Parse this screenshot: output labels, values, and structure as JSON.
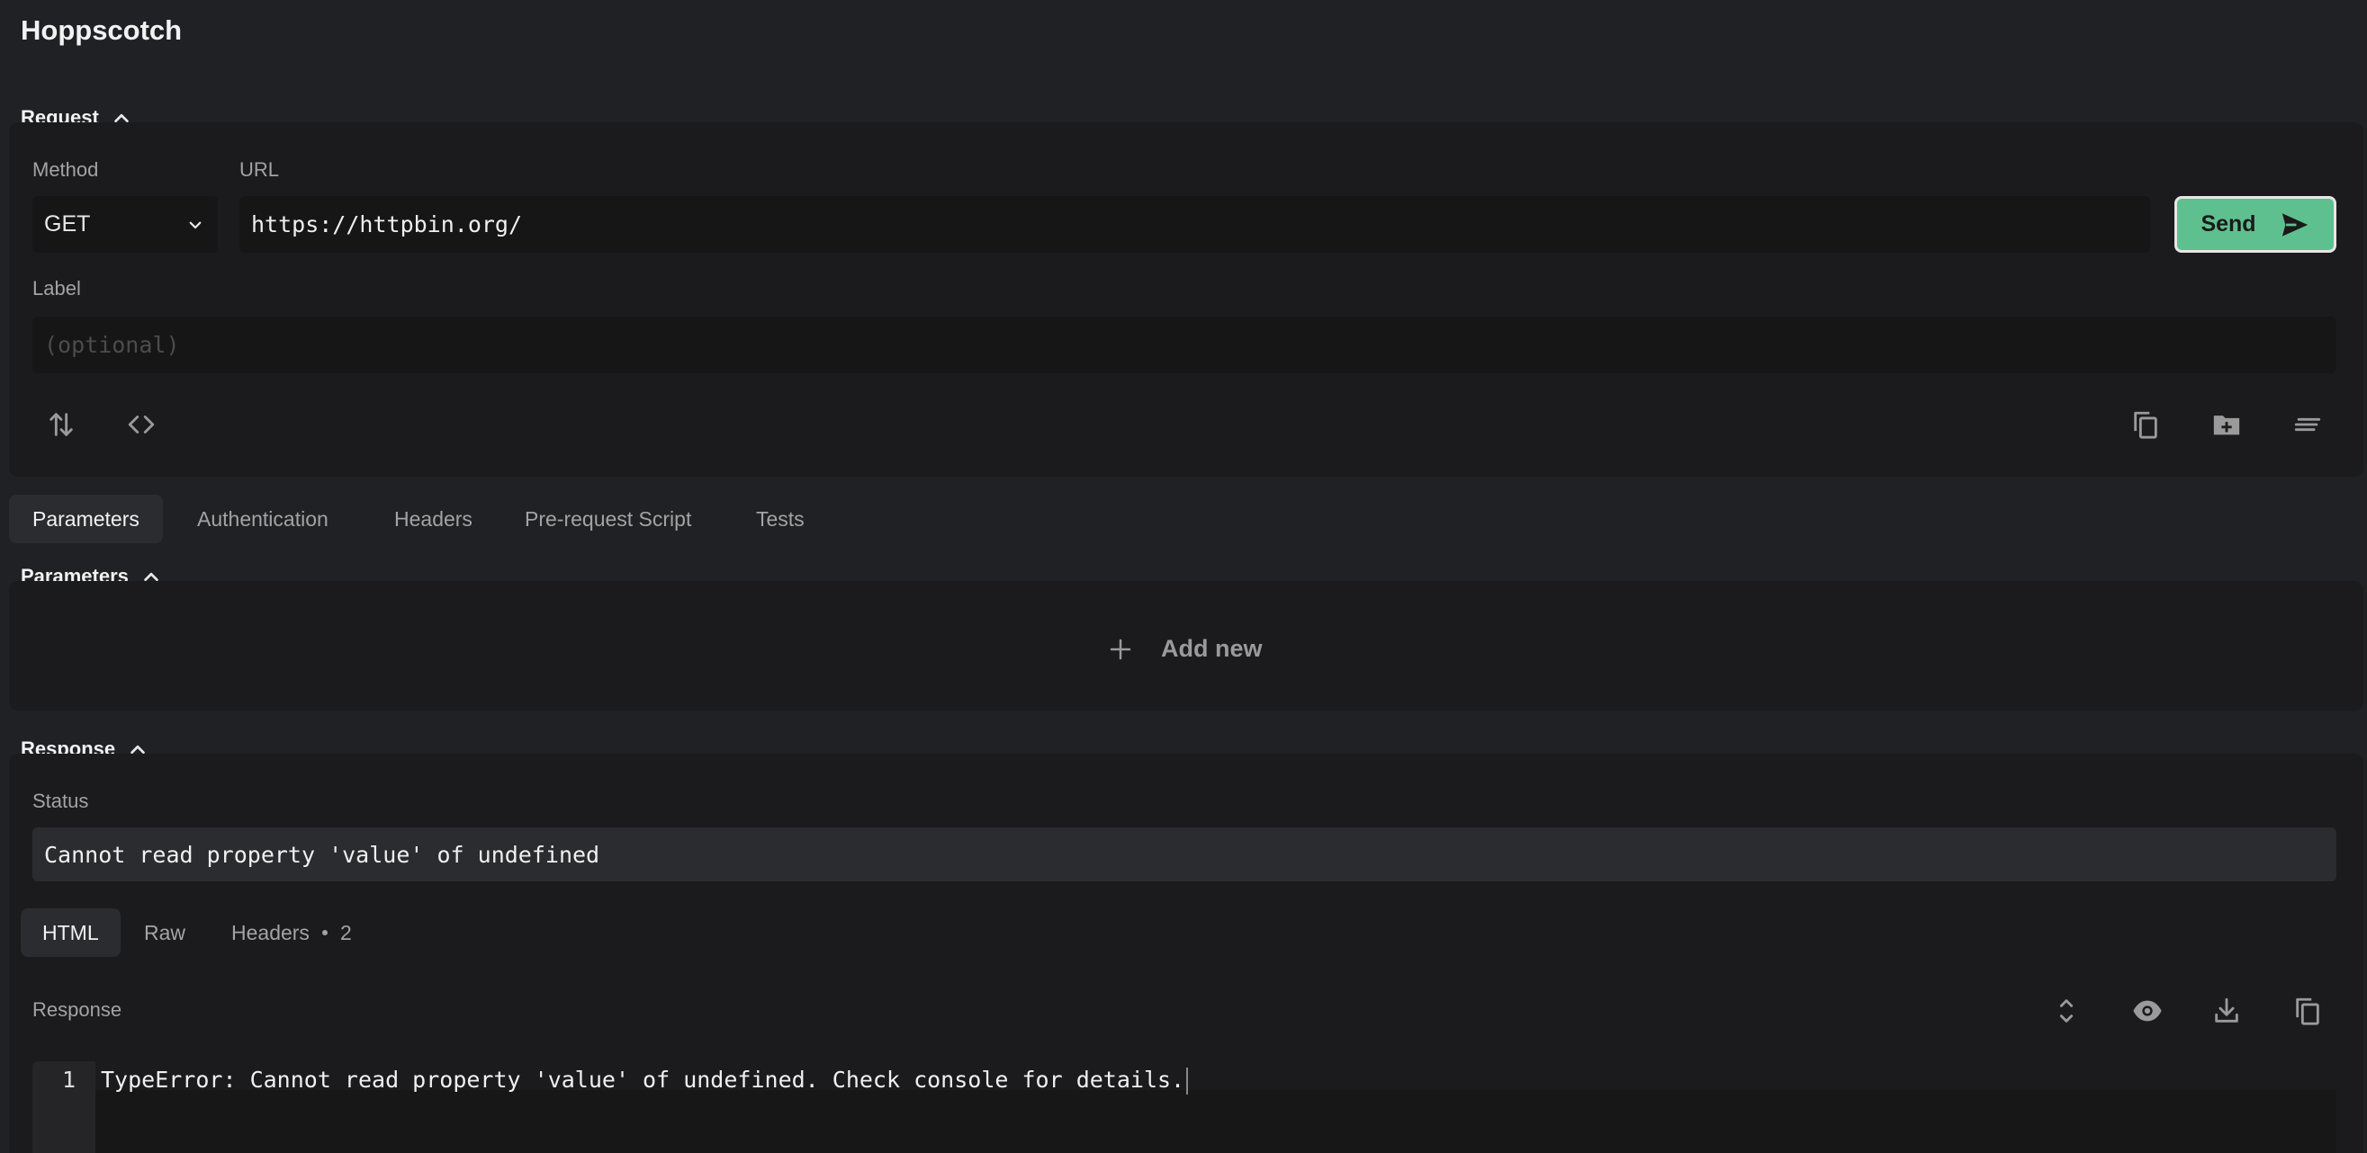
{
  "app": {
    "title": "Hoppscotch"
  },
  "request": {
    "heading": "Request",
    "method_label": "Method",
    "method_value": "GET",
    "url_label": "URL",
    "url_value": "https://httpbin.org/",
    "send_label": "Send",
    "label_label": "Label",
    "label_placeholder": "(optional)"
  },
  "request_tabs": [
    {
      "label": "Parameters",
      "active": true
    },
    {
      "label": "Authentication",
      "active": false
    },
    {
      "label": "Headers",
      "active": false
    },
    {
      "label": "Pre-request Script",
      "active": false
    },
    {
      "label": "Tests",
      "active": false
    }
  ],
  "parameters": {
    "heading": "Parameters",
    "add_new_label": "Add new"
  },
  "response": {
    "heading": "Response",
    "status_label": "Status",
    "status_value": "Cannot read property 'value' of undefined",
    "tabs": [
      {
        "label": "HTML",
        "active": true
      },
      {
        "label": "Raw",
        "active": false
      },
      {
        "label": "Headers",
        "active": false,
        "count": "2"
      }
    ],
    "body_label": "Response",
    "lines": [
      {
        "number": "1",
        "text": "TypeError: Cannot read property 'value' of undefined. Check console for details."
      }
    ]
  },
  "colors": {
    "accent": "#5fc08f",
    "background": "#202124",
    "panel": "#1b1b1d"
  }
}
